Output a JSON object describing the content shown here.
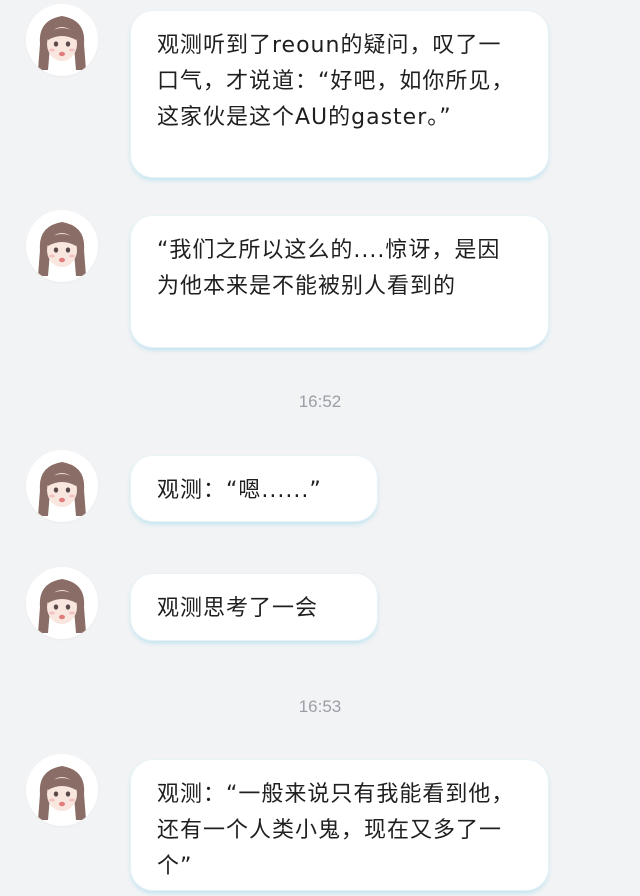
{
  "colors": {
    "background": "#f2f3f5",
    "bubble": "#ffffff",
    "bubble_shadow": "#b6e0ee",
    "text": "#1f1f1f",
    "timestamp": "#9a9ea6"
  },
  "avatar_icon": "anime-girl-avatar-icon",
  "messages": [
    {
      "text": "观测听到了reoun的疑问，叹了一口气，才说道：“好吧，如你所见，这家伙是这个AU的gaster。”"
    },
    {
      "text": "“我们之所以这么的....惊讶，是因为他本来是不能被别人看到的"
    },
    {
      "timestamp": "16:52"
    },
    {
      "text": "观测：“嗯......”"
    },
    {
      "text": "观测思考了一会"
    },
    {
      "timestamp": "16:53"
    },
    {
      "text": "观测：“一般来说只有我能看到他，还有一个人类小鬼，现在又多了一个”"
    }
  ]
}
